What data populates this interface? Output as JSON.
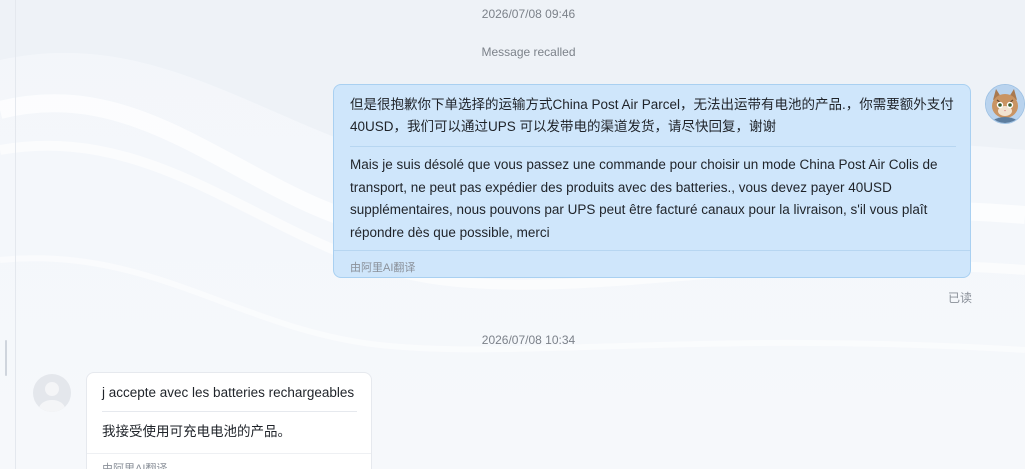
{
  "conversation": {
    "timestamp_1": "2026/07/08 09:46",
    "recalled_text": "Message recalled",
    "timestamp_2": "2026/07/08 10:34"
  },
  "outgoing_message": {
    "original": "但是很抱歉你下单选择的运输方式China Post Air Parcel，无法出运带有电池的产品.，你需要额外支付40USD，我们可以通过UPS 可以发带电的渠道发货，请尽快回复，谢谢",
    "translation": "Mais je suis désolé que vous passez une commande pour choisir un mode China Post Air Colis de transport, ne peut pas expédier des produits avec des batteries., vous devez payer 40USD supplémentaires, nous pouvons par UPS peut être facturé canaux pour la livraison, s'il vous plaît répondre dès que possible, merci",
    "translated_by": "由阿里AI翻译",
    "read_status": "已读",
    "bubble_color": "#cfe6fb",
    "bubble_border_color": "#a9d0f1"
  },
  "incoming_message": {
    "original": "j accepte avec les batteries rechargeables",
    "translation": "我接受使用可充电电池的产品。",
    "translated_by": "由阿里AI翻译",
    "bubble_color": "#ffffff"
  },
  "avatars": {
    "self_icon": "cat-avatar-icon",
    "contact_icon": "default-user-avatar-icon"
  }
}
